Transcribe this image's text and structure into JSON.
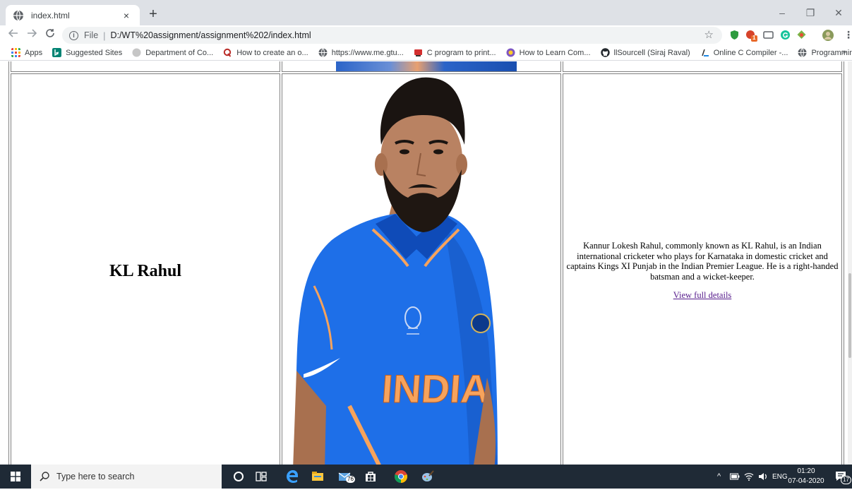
{
  "browser": {
    "tab_title": "index.html",
    "tab_close": "×",
    "new_tab": "+",
    "window_minimize": "–",
    "window_restore": "❐",
    "window_close": "✕",
    "omnibox_scheme": "File",
    "omnibox_separator": "|",
    "omnibox_url": "D:/WT%20assignment/assignment%202/index.html",
    "star": "☆",
    "more_menu": "⋮",
    "extension_badge": "1"
  },
  "bookmarks": [
    {
      "label": "Apps",
      "icon": "apps-grid-icon",
      "color": "#e8453c"
    },
    {
      "label": "Suggested Sites",
      "icon": "bing-icon",
      "color": "#008373"
    },
    {
      "label": "Department of Co...",
      "icon": "globe-icon",
      "color": "#c6c6c6"
    },
    {
      "label": "How to create an o...",
      "icon": "quora-icon",
      "color": "#b92b27"
    },
    {
      "label": "https://www.me.gtu...",
      "icon": "globe-icon",
      "color": "#5f6368"
    },
    {
      "label": "C program to print...",
      "icon": "book-icon",
      "color": "#d32f2f"
    },
    {
      "label": "How to Learn Com...",
      "icon": "wiki-icon",
      "color": "#7e57c2"
    },
    {
      "label": "llSourcell (Siraj Raval)",
      "icon": "github-icon",
      "color": "#24292e"
    },
    {
      "label": "Online C Compiler -...",
      "icon": "compiler-icon",
      "color": "#1e88e5"
    },
    {
      "label": "Programming & En...",
      "icon": "globe-icon",
      "color": "#5f6368"
    }
  ],
  "bookmarks_more": "»",
  "page": {
    "player_name": "KL Rahul",
    "jersey_text": "INDIA",
    "description": "Kannur Lokesh Rahul, commonly known as KL Rahul, is an Indian international cricketer who plays for Karnataka in domestic cricket and captains Kings XI Punjab in the Indian Premier League. He is a right-handed batsman and a wicket-keeper.",
    "link_label": "View full details"
  },
  "taskbar": {
    "search_placeholder": "Type here to search",
    "mail_badge": "76",
    "language": "ENG",
    "time": "01:20",
    "date": "07-04-2020",
    "notification_count": "17",
    "tray_up": "^"
  },
  "colors": {
    "tab_strip": "#dee1e6",
    "taskbar": "#1f2a36",
    "visited_link": "#551a8b",
    "jersey_blue": "#1e6fe8",
    "jersey_orange": "#f7a35c"
  }
}
